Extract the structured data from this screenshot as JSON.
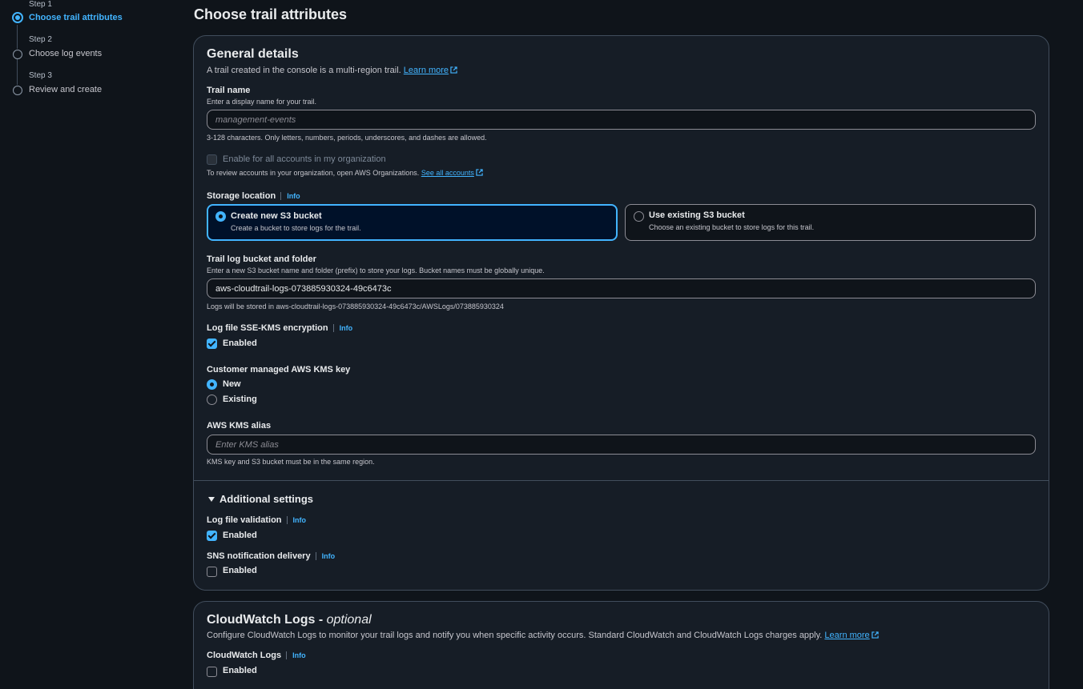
{
  "steps": [
    {
      "num": "Step 1",
      "title": "Choose trail attributes",
      "active": true
    },
    {
      "num": "Step 2",
      "title": "Choose log events",
      "active": false
    },
    {
      "num": "Step 3",
      "title": "Review and create",
      "active": false
    }
  ],
  "page_title": "Choose trail attributes",
  "general": {
    "heading": "General details",
    "description": "A trail created in the console is a multi-region trail.",
    "learn_more": "Learn more",
    "trail_name": {
      "label": "Trail name",
      "description": "Enter a display name for your trail.",
      "placeholder": "management-events",
      "constraint": "3-128 characters. Only letters, numbers, periods, underscores, and dashes are allowed."
    },
    "org": {
      "label": "Enable for all accounts in my organization",
      "hint": "To review accounts in your organization, open AWS Organizations.",
      "see_all": "See all accounts"
    },
    "storage": {
      "label": "Storage location",
      "info": "Info",
      "create_title": "Create new S3 bucket",
      "create_desc": "Create a bucket to store logs for the trail.",
      "existing_title": "Use existing S3 bucket",
      "existing_desc": "Choose an existing bucket to store logs for this trail."
    },
    "bucket": {
      "label": "Trail log bucket and folder",
      "description": "Enter a new S3 bucket name and folder (prefix) to store your logs. Bucket names must be globally unique.",
      "value": "aws-cloudtrail-logs-073885930324-49c6473c",
      "hint": "Logs will be stored in aws-cloudtrail-logs-073885930324-49c6473c/AWSLogs/073885930324"
    },
    "sse": {
      "label": "Log file SSE-KMS encryption",
      "info": "Info",
      "checkbox": "Enabled",
      "checked": true
    },
    "kms_key": {
      "label": "Customer managed AWS KMS key",
      "option_new": "New",
      "option_existing": "Existing",
      "selected": "New"
    },
    "kms_alias": {
      "label": "AWS KMS alias",
      "placeholder": "Enter KMS alias",
      "hint": "KMS key and S3 bucket must be in the same region."
    }
  },
  "additional": {
    "heading": "Additional settings",
    "validation": {
      "label": "Log file validation",
      "info": "Info",
      "checkbox": "Enabled",
      "checked": true
    },
    "sns": {
      "label": "SNS notification delivery",
      "info": "Info",
      "checkbox": "Enabled",
      "checked": false
    }
  },
  "cloudwatch": {
    "heading": "CloudWatch Logs",
    "heading_suffix": "optional",
    "heading_dash": " - ",
    "description": "Configure CloudWatch Logs to monitor your trail logs and notify you when specific activity occurs. Standard CloudWatch and CloudWatch Logs charges apply.",
    "learn_more": "Learn more",
    "field": {
      "label": "CloudWatch Logs",
      "info": "Info",
      "checkbox": "Enabled",
      "checked": false
    }
  },
  "colors": {
    "accent": "#42b4ff",
    "background": "#0f141a",
    "container": "#161d26",
    "border": "#414d5c"
  }
}
